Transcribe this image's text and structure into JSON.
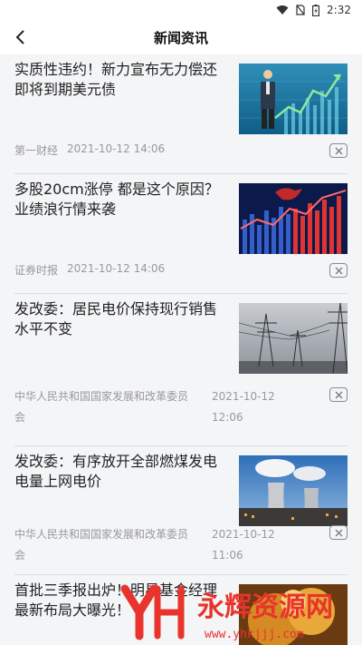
{
  "status_bar": {
    "time": "2:32"
  },
  "header": {
    "title": "新闻资讯"
  },
  "news": [
    {
      "title": "实质性违约！新力宣布无力偿还即将到期美元债",
      "source": "第一财经",
      "date": "2021-10-12 14:06"
    },
    {
      "title": "多股20cm涨停 都是这个原因？业绩浪行情来袭",
      "source": "证券时报",
      "date": "2021-10-12 14:06"
    },
    {
      "title": "发改委：居民电价保持现行销售水平不变",
      "source": "中华人民共和国国家发展和改革委员会",
      "date": "2021-10-12 12:06"
    },
    {
      "title": "发改委：有序放开全部燃煤发电电量上网电价",
      "source": "中华人民共和国国家发展和改革委员会",
      "date": "2021-10-12 11:06"
    },
    {
      "title": "首批三季报出炉！明星基金经理最新布局大曝光！",
      "source": "",
      "date": ""
    }
  ],
  "watermark": {
    "text": "永辉资源网",
    "url": "www.yhkjjj.com"
  }
}
